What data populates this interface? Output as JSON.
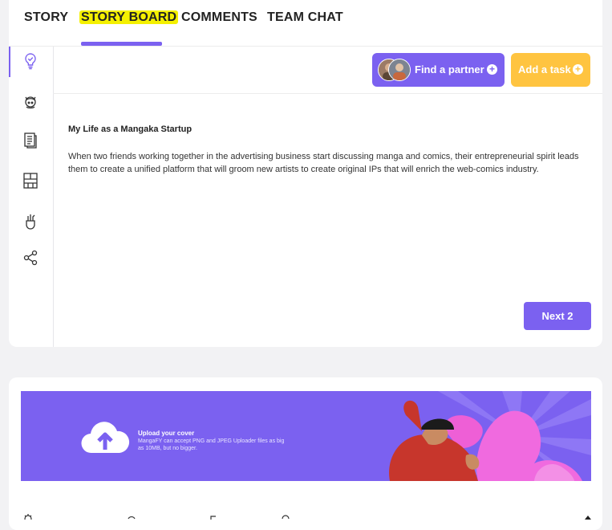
{
  "tabs": [
    {
      "label": "STORY"
    },
    {
      "label": "STORY BOARD"
    },
    {
      "label": "COMMENTS"
    },
    {
      "label": "TEAM CHAT"
    }
  ],
  "active_tab": "STORY BOARD",
  "sidebar": {
    "icons": [
      "lightbulb-check-icon",
      "character-icon",
      "document-icon",
      "storyboard-panels-icon",
      "brush-cup-icon",
      "share-icon"
    ]
  },
  "toolbar": {
    "find_partner_label": "Find a partner",
    "add_task_label": "Add a task"
  },
  "story": {
    "title": "My Life as a Mangaka Startup",
    "body": "When two friends working together in the advertising business start discussing manga and comics, their entrepreneurial spirit leads them to create a unified platform that will groom new artists to create original IPs that will enrich the web-comics industry."
  },
  "next_button_label": "Next 2",
  "upload": {
    "title": "Upload your cover",
    "description": "MangaFY can accept PNG and JPEG Uploader files as big as 10MB, but no bigger."
  },
  "colors": {
    "accent": "#7b61f0",
    "task": "#ffc440",
    "highlight": "#f4f000",
    "background": "#f2f2f4"
  }
}
